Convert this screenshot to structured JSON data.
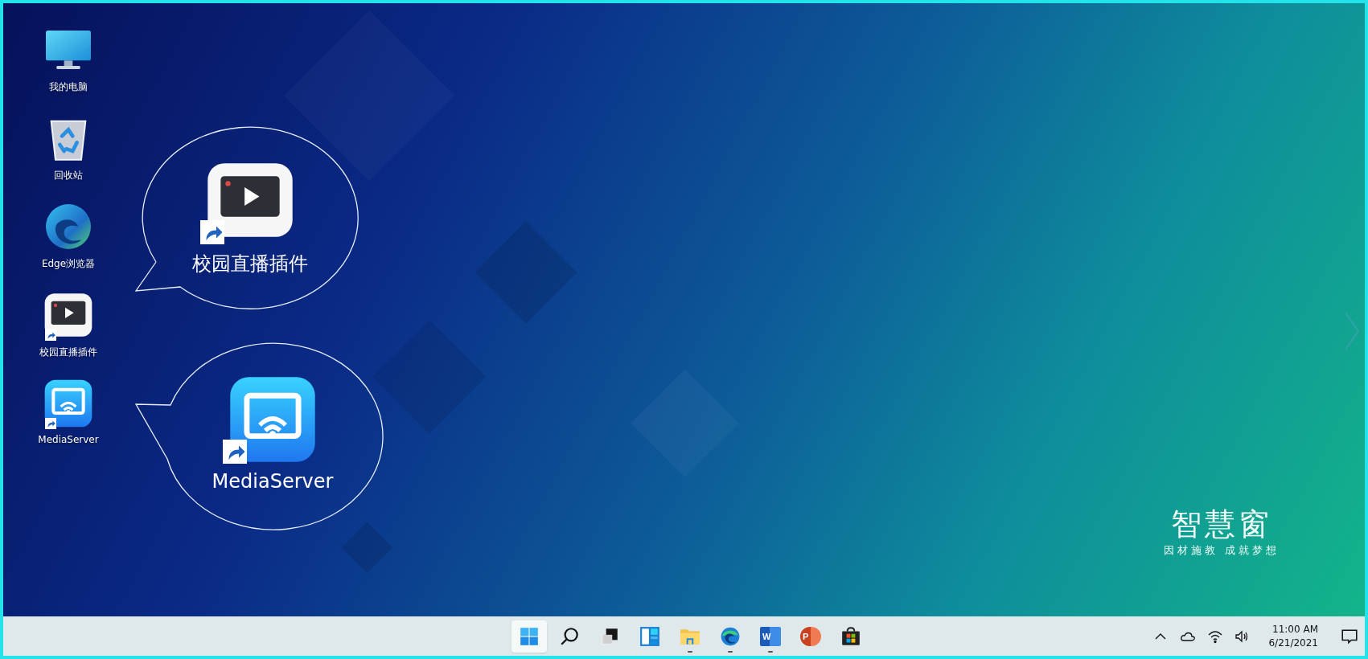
{
  "desktop_icons": [
    {
      "kind": "computer",
      "label": "我的电脑",
      "shortcut": false
    },
    {
      "kind": "recycle-bin",
      "label": "回收站",
      "shortcut": false
    },
    {
      "kind": "browser",
      "label": "Edge浏览器",
      "shortcut": false
    },
    {
      "kind": "video-player",
      "label": "校园直播插件",
      "shortcut": true
    },
    {
      "kind": "cast",
      "label": "MediaServer",
      "shortcut": true
    }
  ],
  "callouts": [
    {
      "kind": "video-player",
      "label": "校园直播插件",
      "shortcut": true
    },
    {
      "kind": "cast",
      "label": "MediaServer",
      "shortcut": true
    }
  ],
  "logo": {
    "title": "智慧窗",
    "slogan": "因材施教 成就梦想"
  },
  "taskbar": {
    "apps": [
      {
        "kind": "start",
        "selected": true,
        "running": false
      },
      {
        "kind": "search",
        "selected": false,
        "running": false
      },
      {
        "kind": "task-view",
        "selected": false,
        "running": false
      },
      {
        "kind": "widgets",
        "selected": false,
        "running": false
      },
      {
        "kind": "file-explorer",
        "selected": false,
        "running": true
      },
      {
        "kind": "browser",
        "selected": false,
        "running": true
      },
      {
        "kind": "word",
        "letter": "W",
        "selected": false,
        "running": true
      },
      {
        "kind": "powerpoint",
        "letter": "P",
        "selected": false,
        "running": false
      },
      {
        "kind": "store",
        "selected": false,
        "running": false
      }
    ],
    "tray": [
      {
        "kind": "chevron-up"
      },
      {
        "kind": "cloud"
      },
      {
        "kind": "wifi"
      },
      {
        "kind": "volume"
      }
    ],
    "clock": {
      "time": "11:00 AM",
      "date": "6/21/2021"
    }
  }
}
